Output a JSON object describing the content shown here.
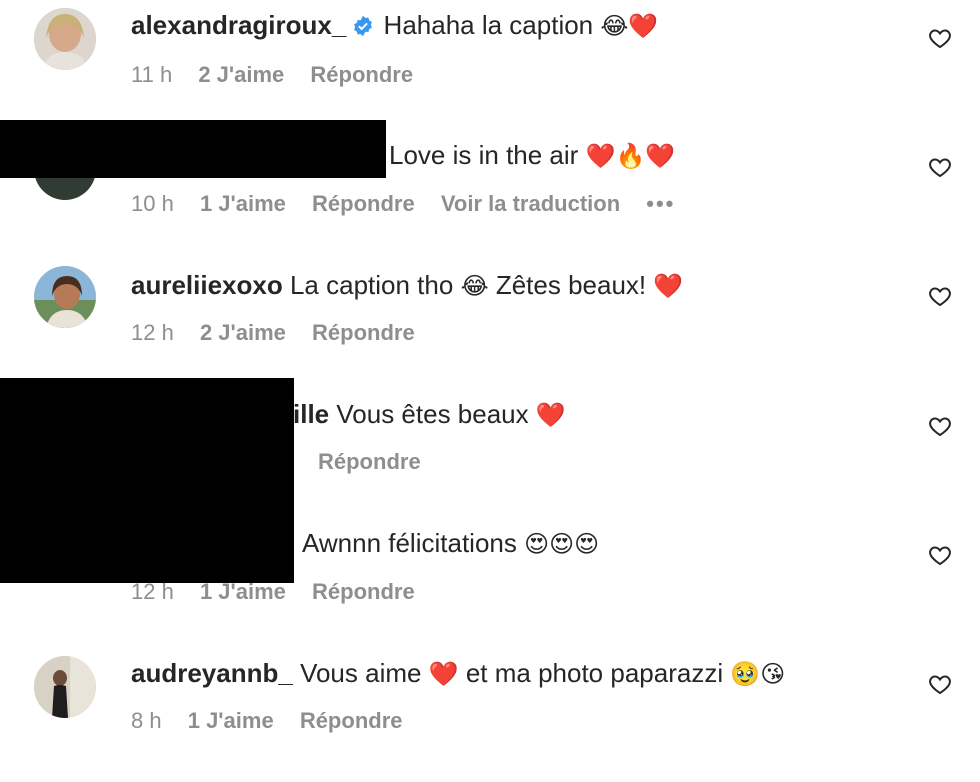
{
  "comments": [
    {
      "username": "alexandragiroux_",
      "verified": true,
      "text": "Hahaha la caption",
      "emoji": "😂❤️",
      "time": "11 h",
      "likes": "2 J'aime",
      "reply": "Répondre"
    },
    {
      "username": "",
      "text": "Love is in the air",
      "emoji": "❤️🔥❤️",
      "time": "10 h",
      "likes": "1 J'aime",
      "reply": "Répondre",
      "translate": "Voir la traduction",
      "more": "•••"
    },
    {
      "username": "aureliiexoxo",
      "text": "La caption tho",
      "emoji1": "😂",
      "text2": "Zêtes beaux!",
      "emoji2": "❤️",
      "time": "12 h",
      "likes": "2 J'aime",
      "reply": "Répondre"
    },
    {
      "username_partial": "ille",
      "text": "Vous êtes beaux",
      "emoji": "❤️",
      "reply": "Répondre"
    },
    {
      "text": "Awnnn félicitations",
      "emoji": "😍😍😍",
      "time": "12 h",
      "likes": "1 J'aime",
      "reply": "Répondre"
    },
    {
      "username": "audreyannb_",
      "text": "Vous aime",
      "emoji1": "❤️",
      "text2": "et ma photo paparazzi",
      "emoji2": "🥹😘",
      "time": "8 h",
      "likes": "1 J'aime",
      "reply": "Répondre"
    }
  ],
  "icons": {
    "heart": "heart-outline-icon",
    "verified": "verified-badge-icon",
    "verified_color": "#3897f0",
    "more": "more-options-icon"
  }
}
